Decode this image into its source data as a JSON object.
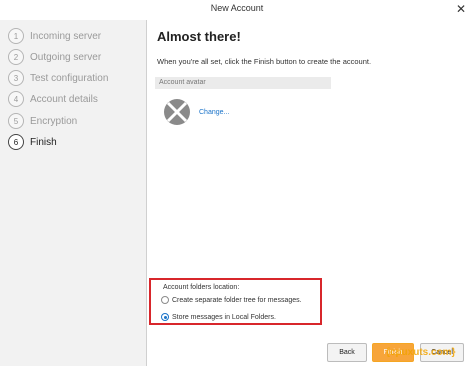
{
  "window": {
    "title": "New Account",
    "close_glyph": "✕"
  },
  "sidebar": {
    "steps": [
      {
        "num": "1",
        "label": "Incoming server"
      },
      {
        "num": "2",
        "label": "Outgoing server"
      },
      {
        "num": "3",
        "label": "Test configuration"
      },
      {
        "num": "4",
        "label": "Account details"
      },
      {
        "num": "5",
        "label": "Encryption"
      },
      {
        "num": "6",
        "label": "Finish"
      }
    ]
  },
  "main": {
    "heading": "Almost there!",
    "intro": "When you're all set, click the Finish button to create the account.",
    "avatar_section": {
      "label": "Account avatar",
      "change_link": "Change..."
    },
    "folders": {
      "label": "Account folders location:",
      "options": [
        {
          "label": "Create separate folder tree for messages.",
          "checked": false
        },
        {
          "label": "Store messages in Local Folders.",
          "checked": true
        }
      ]
    }
  },
  "footer": {
    "back_label": "Back",
    "finish_label": "Finish",
    "cancel_label": "Cancel"
  },
  "watermark": "{cpuxuts.com}",
  "colors": {
    "accent": "#1a73c9",
    "finish": "#f7a53a",
    "highlight_box": "#d8262b"
  }
}
